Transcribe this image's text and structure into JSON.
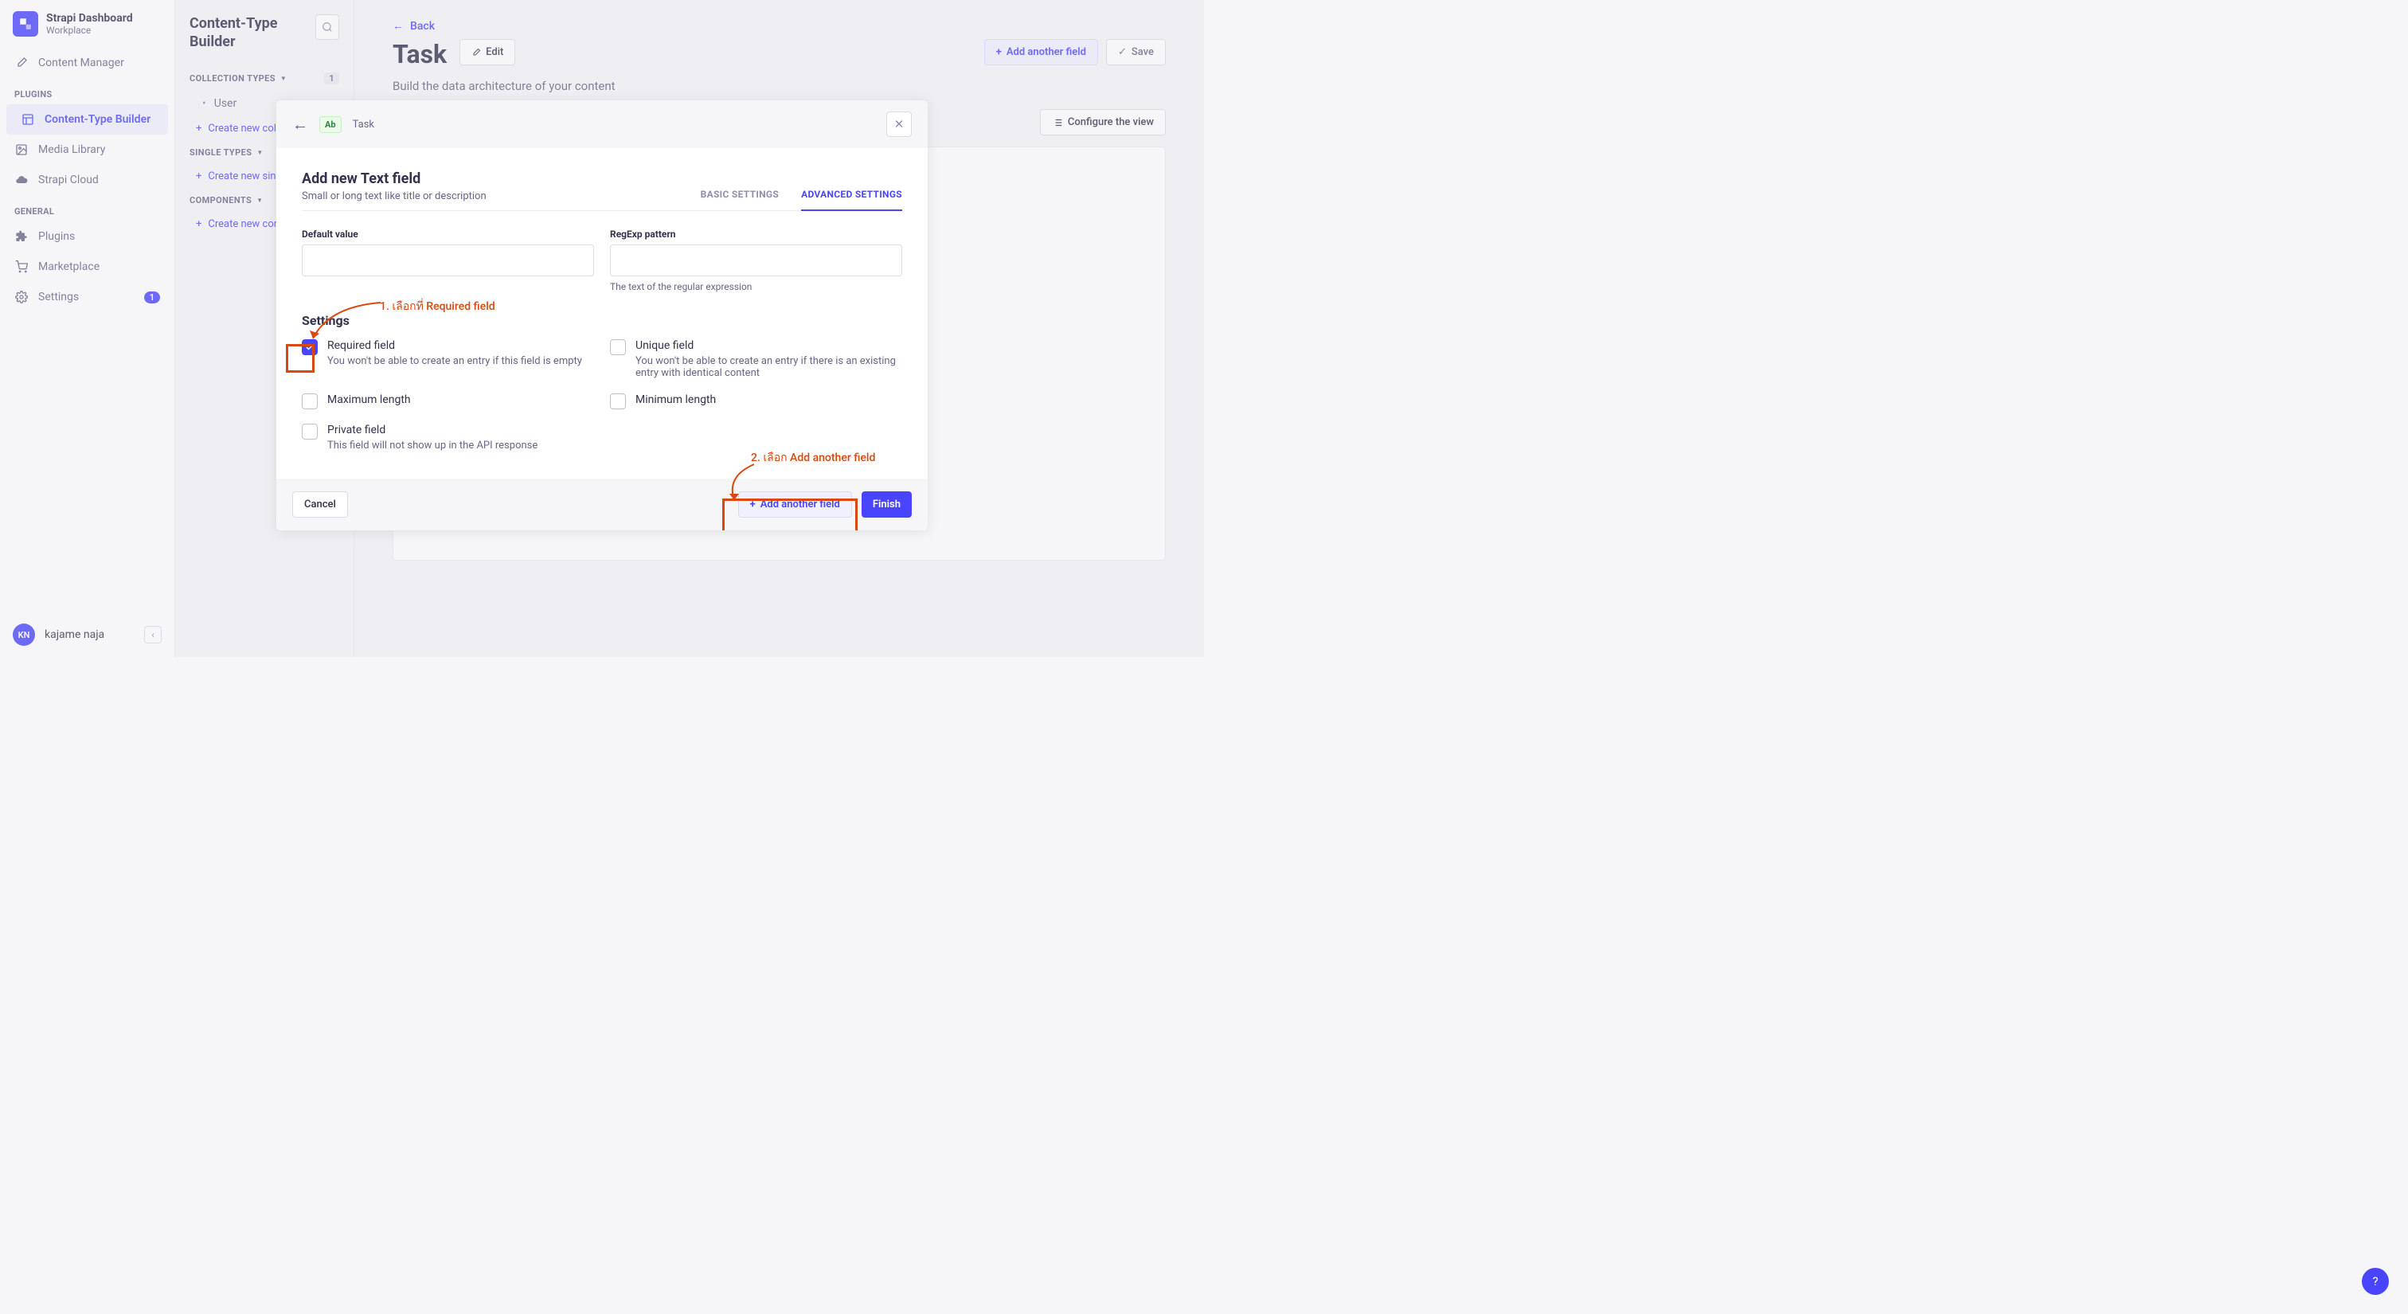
{
  "sidebar": {
    "brand_title": "Strapi Dashboard",
    "brand_sub": "Workplace",
    "items": {
      "content_manager": "Content Manager",
      "plugins_header": "PLUGINS",
      "ctb": "Content-Type Builder",
      "media": "Media Library",
      "cloud": "Strapi Cloud",
      "general_header": "GENERAL",
      "plugins": "Plugins",
      "marketplace": "Marketplace",
      "settings": "Settings",
      "settings_badge": "1"
    },
    "user_initials": "KN",
    "user_name": "kajame naja"
  },
  "panel2": {
    "title": "Content-Type Builder",
    "collection_types": "COLLECTION TYPES",
    "collection_count": "1",
    "item_user": "User",
    "create_collection": "Create new collection type",
    "single_types": "SINGLE TYPES",
    "create_single": "Create new single type",
    "components": "COMPONENTS",
    "create_component": "Create new component"
  },
  "main": {
    "back": "Back",
    "title": "Task",
    "edit": "Edit",
    "add_field": "Add another field",
    "save": "Save",
    "subtitle": "Build the data architecture of your content",
    "configure": "Configure the view"
  },
  "modal": {
    "chip": "Ab",
    "crumb": "Task",
    "title": "Add new Text field",
    "subtitle": "Small or long text like title or description",
    "tab_basic": "BASIC SETTINGS",
    "tab_advanced": "ADVANCED SETTINGS",
    "default_value_label": "Default value",
    "regexp_label": "RegExp pattern",
    "regexp_hint": "The text of the regular expression",
    "settings_h": "Settings",
    "required_label": "Required field",
    "required_desc": "You won't be able to create an entry if this field is empty",
    "unique_label": "Unique field",
    "unique_desc": "You won't be able to create an entry if there is an existing entry with identical content",
    "max_label": "Maximum length",
    "min_label": "Minimum length",
    "private_label": "Private field",
    "private_desc": "This field will not show up in the API response",
    "cancel": "Cancel",
    "add_another": "Add another field",
    "finish": "Finish"
  },
  "annotations": {
    "a1": "1. เลือกที่ Required field",
    "a2": "2. เลือก Add another field"
  },
  "help": "?"
}
